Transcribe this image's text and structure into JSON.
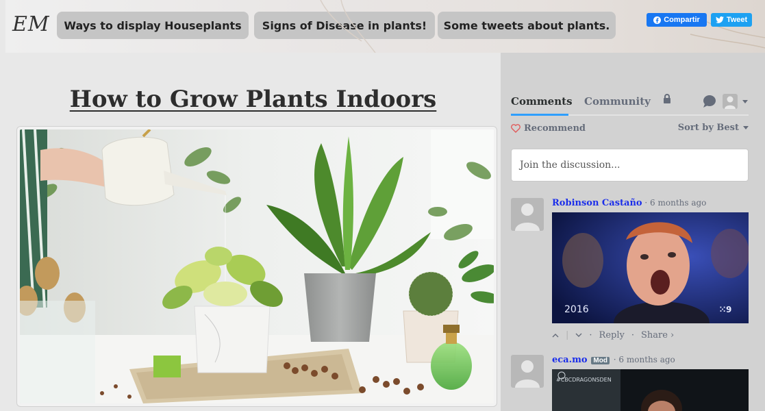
{
  "header": {
    "logo": "EM",
    "nav": [
      {
        "label": "Ways to display Houseplants"
      },
      {
        "label": "Signs of Disease in plants!"
      },
      {
        "label": "Some tweets about plants."
      }
    ],
    "share": {
      "facebook": "Compartir",
      "twitter": "Tweet"
    }
  },
  "main": {
    "title": "How to Grow Plants Indoors"
  },
  "disqus": {
    "tabs": {
      "comments": "Comments",
      "community": "Community"
    },
    "recommend": "Recommend",
    "sort": "Sort by Best",
    "join_placeholder": "Join the discussion...",
    "comments": [
      {
        "author": "Robinson Castaño",
        "badge": "",
        "time": "6 months ago",
        "reply": "Reply",
        "share": "Share ›",
        "gif_text": "2016"
      },
      {
        "author": "eca.mo",
        "badge": "Mod",
        "time": "6 months ago",
        "gif_text": "#CBCDRAGONSDEN"
      }
    ]
  },
  "colors": {
    "accent": "#2e9fff",
    "author_link": "#1b2eea",
    "facebook": "#1877f2",
    "twitter": "#1da1f2",
    "nav_button": "#c5c5c5"
  }
}
